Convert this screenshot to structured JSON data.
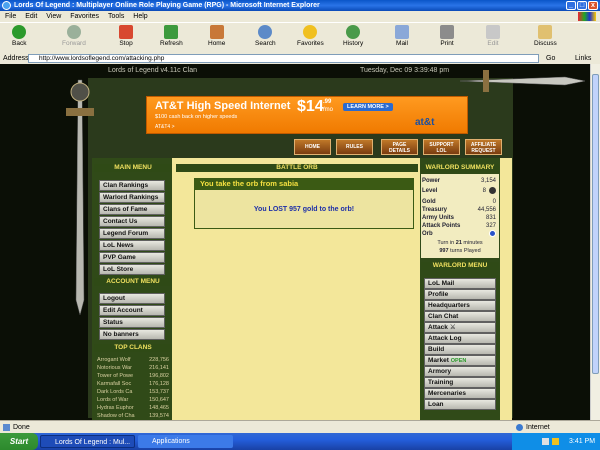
{
  "window": {
    "title": "Lords Of Legend : Multiplayer Online Role Playing Game (RPG) - Microsoft Internet Explorer"
  },
  "menubar": [
    "File",
    "Edit",
    "View",
    "Favorites",
    "Tools",
    "Help"
  ],
  "toolbar": {
    "back": "Back",
    "forward": "Forward",
    "stop": "Stop",
    "refresh": "Refresh",
    "home": "Home",
    "search": "Search",
    "favorites": "Favorites",
    "history": "History",
    "mail": "Mail",
    "print": "Print",
    "edit": "Edit",
    "discuss": "Discuss"
  },
  "address": {
    "label": "Address",
    "url": "http://www.lordsoflegend.com/attacking.php",
    "go": "Go",
    "links": "Links"
  },
  "game": {
    "title": "Lords of Legend v4.11c Clan",
    "date": "Tuesday, Dec 09 3:39:48 pm"
  },
  "banner": {
    "headline": "AT&T High Speed Internet",
    "price_dollars": "$14",
    "price_cents": ".99",
    "price_unit": "/mo",
    "sub": "$100 cash back on higher speeds",
    "fine": "AT&T4 >",
    "learn_more": "LEARN MORE >",
    "brand": "at&t"
  },
  "nav": [
    "HOME",
    "RULES",
    "PAGE DETAILS",
    "SUPPORT LOL",
    "AFFILIATE REQUEST"
  ],
  "main_menu": {
    "title": "MAIN MENU",
    "items": [
      "Clan Rankings",
      "Warlord Rankings",
      "Clans of Fame",
      "Contact Us",
      "Legend Forum",
      "LoL News",
      "PVP Game",
      "LoL Store"
    ]
  },
  "account_menu": {
    "title": "ACCOUNT MENU",
    "items": [
      "Logout",
      "Edit Account",
      "Status",
      "No banners"
    ]
  },
  "top_clans": {
    "title": "TOP CLANS",
    "rows": [
      {
        "name": "Arrogant Wolf",
        "value": "228,756"
      },
      {
        "name": "Notorious War",
        "value": "216,141"
      },
      {
        "name": "Tower of Powe",
        "value": "196,802"
      },
      {
        "name": "Karmafall Soc",
        "value": "176,128"
      },
      {
        "name": "Dark Lords Ca",
        "value": "153,737"
      },
      {
        "name": "Lords of War",
        "value": "150,647"
      },
      {
        "name": "Hydras Euphor",
        "value": "148,465"
      },
      {
        "name": "Shadow of Cha",
        "value": "139,574"
      }
    ]
  },
  "battle": {
    "title": "BATTLE ORB",
    "heading": "You take the orb from sabia",
    "message": "You LOST 957 gold to the orb!"
  },
  "summary": {
    "title": "WARLORD SUMMARY",
    "rows": [
      {
        "label": "Power",
        "value": "3,154"
      },
      {
        "label": "Level",
        "value": "8"
      },
      {
        "label": "Gold",
        "value": "0"
      },
      {
        "label": "Treasury",
        "value": "44,556"
      },
      {
        "label": "Army Units",
        "value": "831"
      },
      {
        "label": "Attack Points",
        "value": "327"
      },
      {
        "label": "Orb",
        "value": ""
      }
    ],
    "turn_prefix": "Turn in",
    "turn_minutes": "21",
    "turn_suffix": "minutes",
    "turns_played": "997",
    "turns_played_label": "turns Played"
  },
  "warlord_menu": {
    "title": "WARLORD MENU",
    "items": [
      "LoL Mail",
      "Profile",
      "Headquarters",
      "Clan Chat",
      "Attack",
      "Attack Log",
      "Build",
      "Market",
      "Armory",
      "Training",
      "Mercenaries",
      "Loan"
    ],
    "market_badge": "OPEN"
  },
  "statusbar": {
    "left": "Done",
    "zone": "Internet"
  },
  "taskbar": {
    "start": "Start",
    "tasks": [
      "Lords Of Legend : Mul...",
      "Applications"
    ],
    "clock": "3:41 PM"
  }
}
